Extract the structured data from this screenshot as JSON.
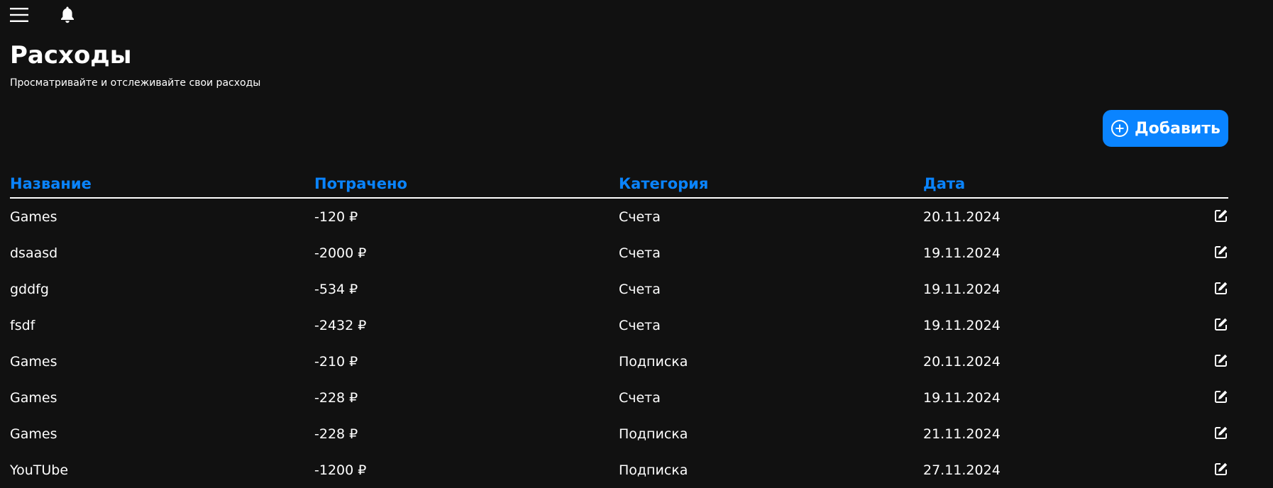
{
  "header": {
    "menu_icon": "hamburger-menu-icon",
    "notification_icon": "bell-icon"
  },
  "page": {
    "title": "Расходы",
    "subtitle": "Просматривайте и отслеживайте свои расходы"
  },
  "actions": {
    "add_label": "Добавить",
    "add_icon": "plus-circle-icon"
  },
  "colors": {
    "background": "#111111",
    "accent": "#0a84ff",
    "text": "#ffffff"
  },
  "table": {
    "columns": [
      "Название",
      "Потрачено",
      "Категория",
      "Дата"
    ],
    "rows": [
      {
        "name": "Games",
        "spent": "-120 ₽",
        "category": "Счета",
        "date": "20.11.2024"
      },
      {
        "name": "dsaasd",
        "spent": "-2000 ₽",
        "category": "Счета",
        "date": "19.11.2024"
      },
      {
        "name": "gddfg",
        "spent": "-534 ₽",
        "category": "Счета",
        "date": "19.11.2024"
      },
      {
        "name": "fsdf",
        "spent": "-2432 ₽",
        "category": "Счета",
        "date": "19.11.2024"
      },
      {
        "name": "Games",
        "spent": "-210 ₽",
        "category": "Подписка",
        "date": "20.11.2024"
      },
      {
        "name": "Games",
        "spent": "-228 ₽",
        "category": "Счета",
        "date": "19.11.2024"
      },
      {
        "name": "Games",
        "spent": "-228 ₽",
        "category": "Подписка",
        "date": "21.11.2024"
      },
      {
        "name": "YouTUbe",
        "spent": "-1200 ₽",
        "category": "Подписка",
        "date": "27.11.2024"
      }
    ],
    "edit_icon": "edit-icon"
  }
}
